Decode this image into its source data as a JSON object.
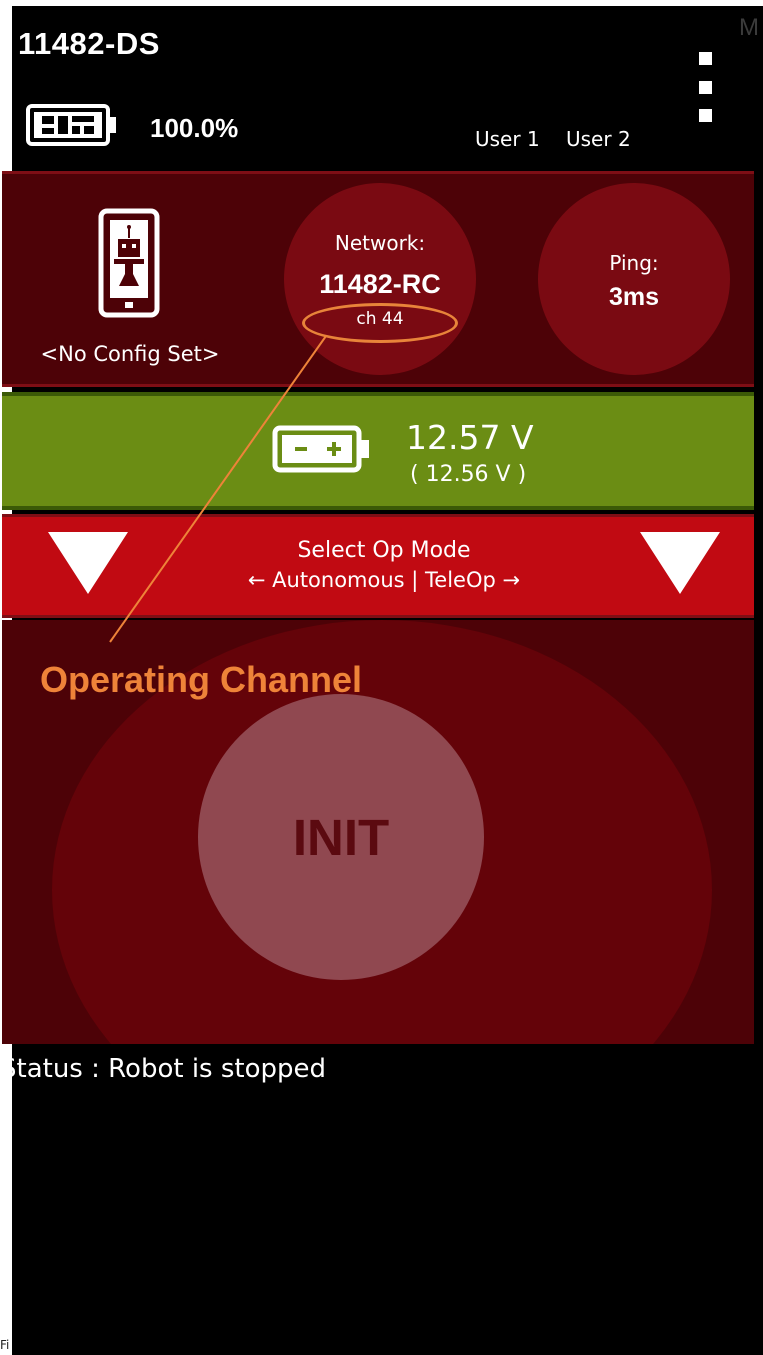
{
  "header": {
    "app_title": "11482-DS",
    "phone_battery": "100.0%",
    "users": [
      "User 1",
      "User 2"
    ],
    "top_right_fragment": "M"
  },
  "config": {
    "label": "<No Config Set>"
  },
  "network": {
    "label": "Network:",
    "name": "11482-RC",
    "channel": "ch 44"
  },
  "ping": {
    "label": "Ping:",
    "value": "3ms"
  },
  "robot_battery": {
    "voltage": "12.57 V",
    "min_voltage": "( 12.56 V )"
  },
  "opmode": {
    "title": "Select Op Mode",
    "hint": "← Autonomous | TeleOp →"
  },
  "init": {
    "label": "INIT"
  },
  "annotation": {
    "label": "Operating Channel",
    "color": "#ee8339"
  },
  "status": {
    "text": "Status : Robot is stopped"
  },
  "footer": {
    "corner_fragment": "Fi"
  },
  "colors": {
    "panel_bg": "#4d0207",
    "circle_bg": "#7a0a12",
    "battery_green": "#6b8d14",
    "opmode_red": "#c10a12",
    "init_button": "#904850"
  }
}
